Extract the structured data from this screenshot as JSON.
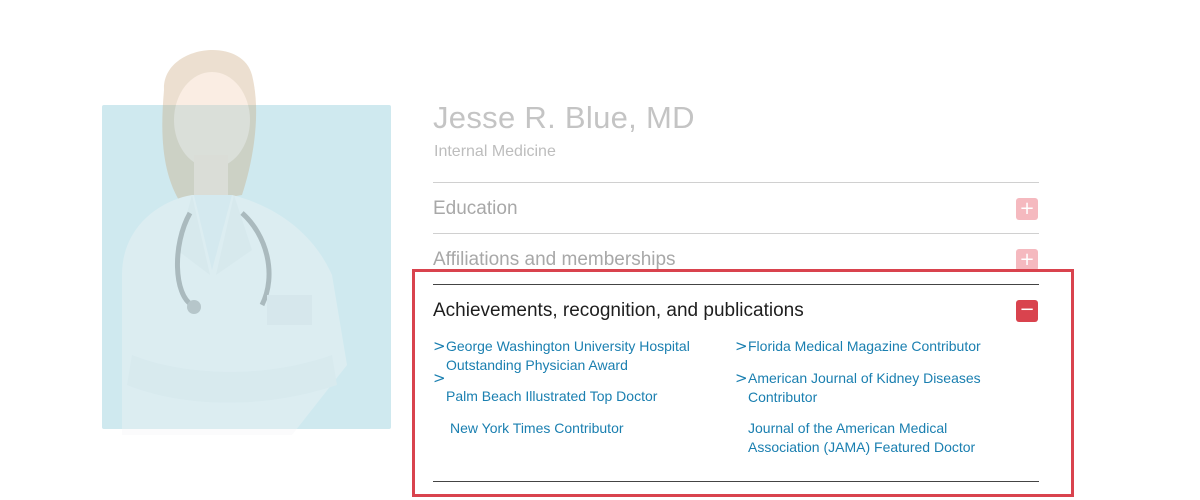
{
  "doctor": {
    "name": "Jesse R. Blue, MD",
    "specialty": "Internal Medicine"
  },
  "accordion": {
    "sections": [
      {
        "label": "Education",
        "state": "collapsed",
        "toggle_icon": "plus-icon"
      },
      {
        "label": "Affiliations and memberships",
        "state": "collapsed",
        "toggle_icon": "plus-icon"
      },
      {
        "label": "Achievements, recognition, and publications",
        "state": "expanded",
        "toggle_icon": "minus-icon"
      }
    ],
    "plus_glyph": "+",
    "minus_glyph": "−"
  },
  "achievements": {
    "chevron": ">",
    "left": [
      "George Washington University Hospital Outstanding Physician Award",
      "Palm Beach Illustrated Top Doctor",
      "New York Times Contributor"
    ],
    "right": [
      "Florida Medical Magazine Contributor",
      "American Journal of Kidney Diseases Contributor",
      "Journal of the American Medical Association (JAMA) Featured Doctor"
    ]
  },
  "colors": {
    "accent": "#d9434e",
    "link": "#1a7fb0",
    "photo_background": "#cfe9ef"
  }
}
